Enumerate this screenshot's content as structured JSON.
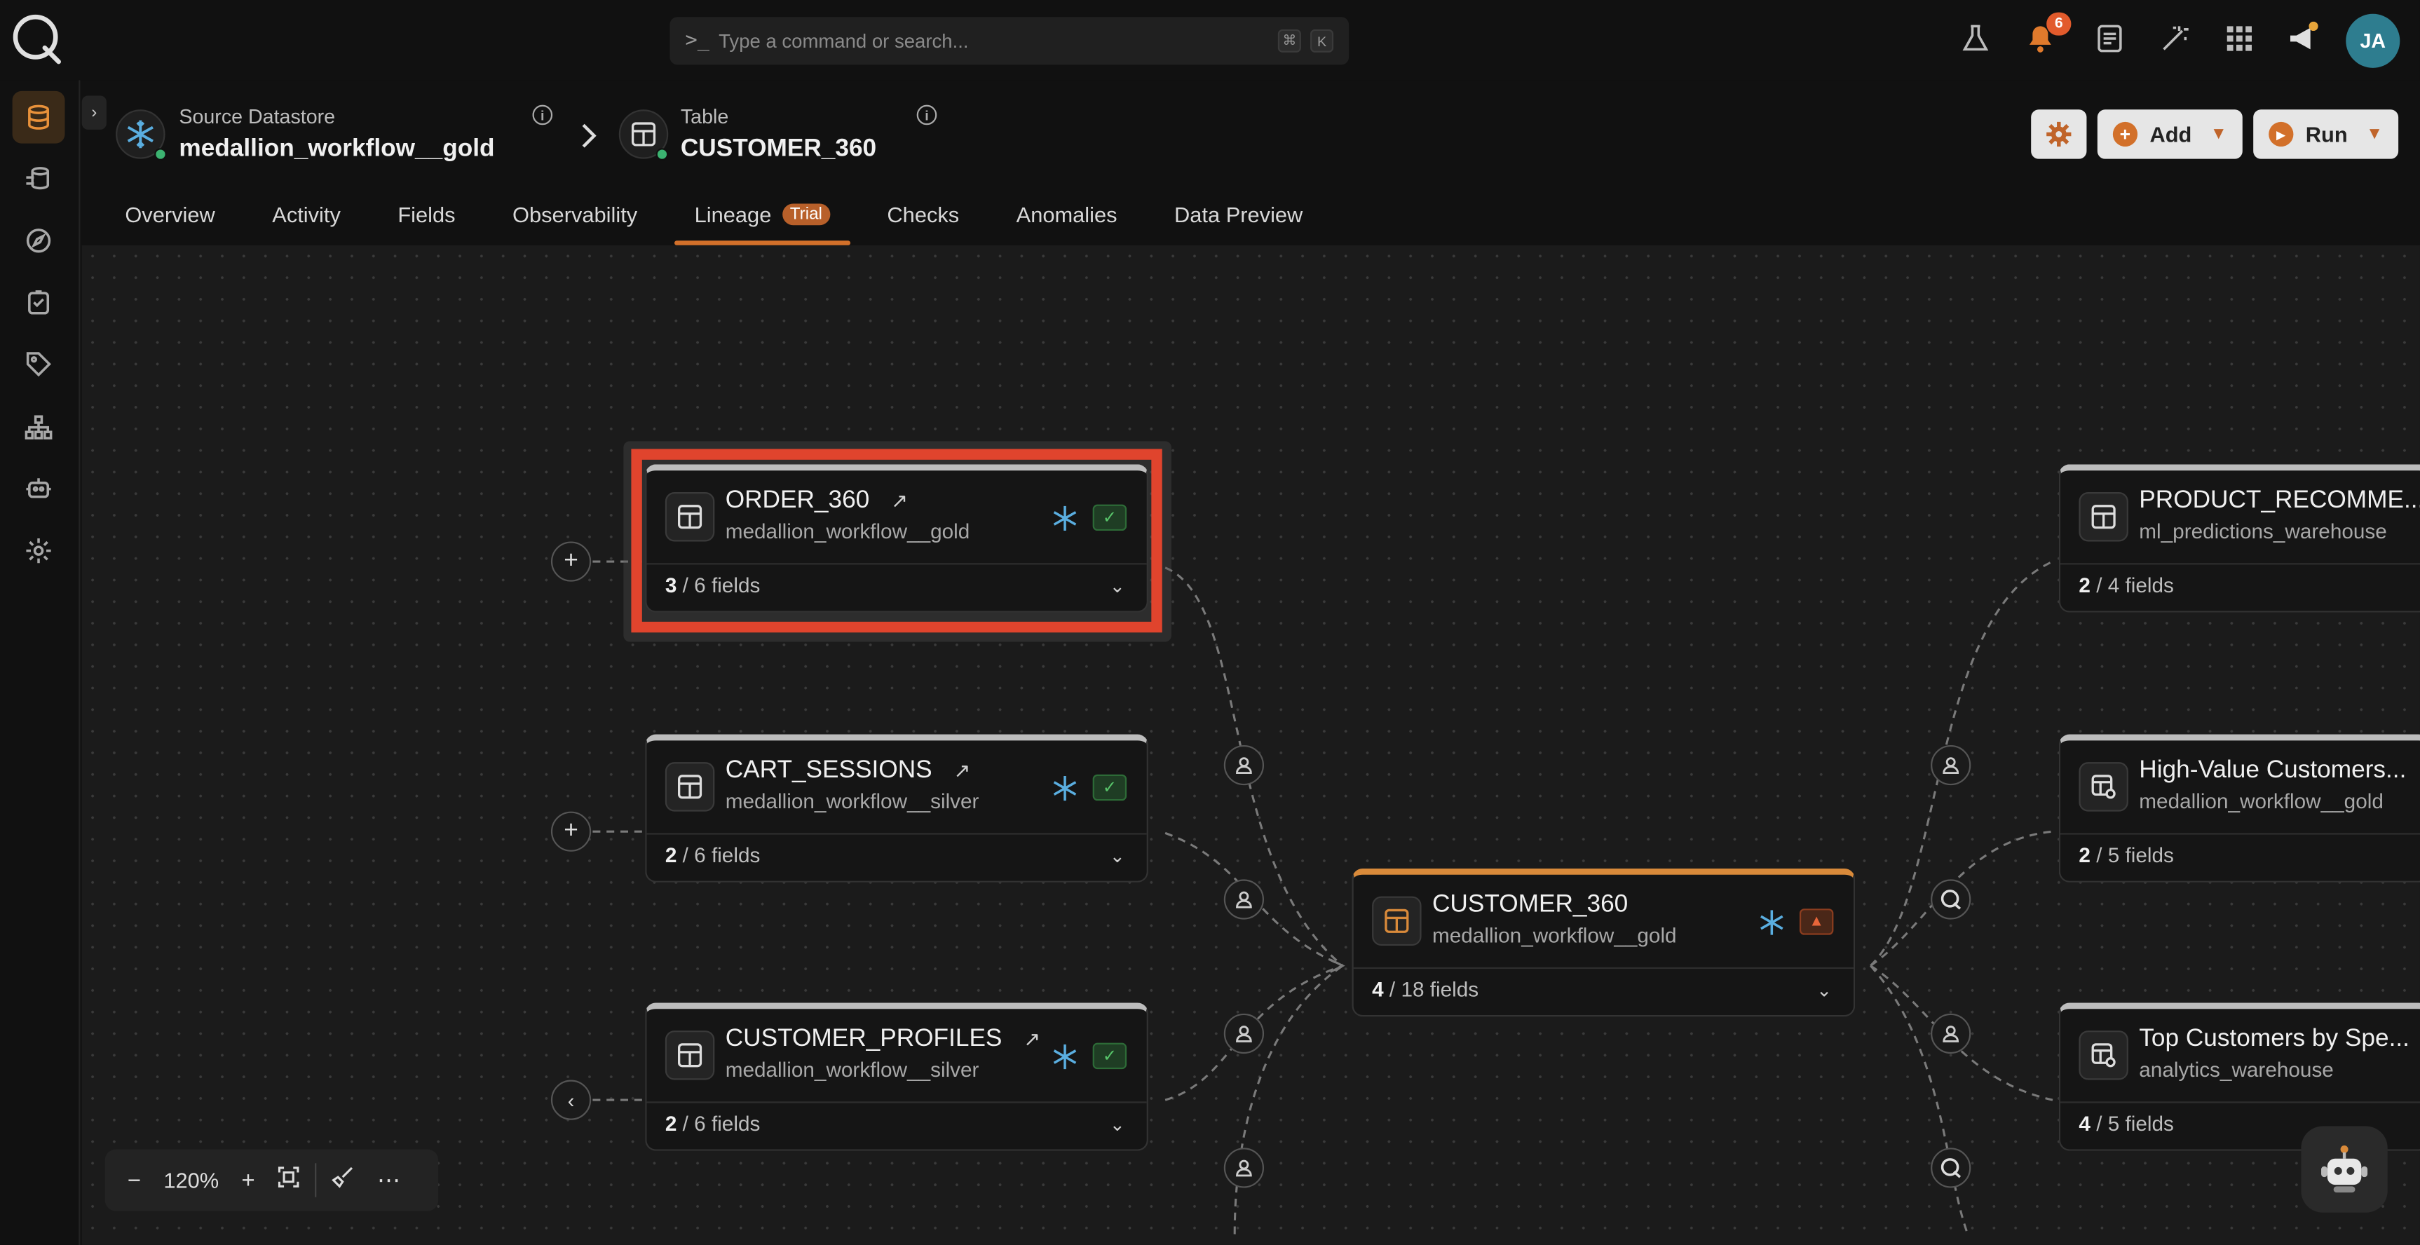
{
  "command": {
    "prompt": ">_",
    "placeholder": "Type a command or search...",
    "kbd1": "⌘",
    "kbd2": "K"
  },
  "notifications": {
    "count": "6"
  },
  "user": {
    "initials": "JA"
  },
  "breadcrumb": {
    "source_label": "Source Datastore",
    "source_value": "medallion_workflow__gold",
    "table_label": "Table",
    "table_value": "CUSTOMER_360",
    "info": "i"
  },
  "actions": {
    "add": "Add",
    "run": "Run"
  },
  "tabs": {
    "overview": "Overview",
    "activity": "Activity",
    "fields": "Fields",
    "observability": "Observability",
    "lineage": "Lineage",
    "trial": "Trial",
    "checks": "Checks",
    "anomalies": "Anomalies",
    "preview": "Data Preview"
  },
  "nodes": {
    "order": {
      "name": "ORDER_360",
      "sub": "medallion_workflow__gold",
      "count": "3",
      "total": " / 6 fields"
    },
    "cart": {
      "name": "CART_SESSIONS",
      "sub": "medallion_workflow__silver",
      "count": "2",
      "total": " / 6 fields"
    },
    "profiles": {
      "name": "CUSTOMER_PROFILES",
      "sub": "medallion_workflow__silver",
      "count": "2",
      "total": " / 6 fields"
    },
    "customer": {
      "name": "CUSTOMER_360",
      "sub": "medallion_workflow__gold",
      "count": "4",
      "total": " / 18 fields"
    },
    "product": {
      "name": "PRODUCT_RECOMME...",
      "sub": "ml_predictions_warehouse",
      "count": "2",
      "total": " / 4 fields"
    },
    "highvalue": {
      "name": "High-Value Customers...",
      "sub": "medallion_workflow__gold",
      "count": "2",
      "total": " / 5 fields"
    },
    "top": {
      "name": "Top Customers by Spe...",
      "sub": "analytics_warehouse",
      "count": "4",
      "total": " / 5 fields"
    }
  },
  "zoom": {
    "level": "120%"
  },
  "colors": {
    "accent": "#d2702a",
    "selection": "#e0442d",
    "ok": "#58c46a",
    "warning": "#e8663a"
  }
}
